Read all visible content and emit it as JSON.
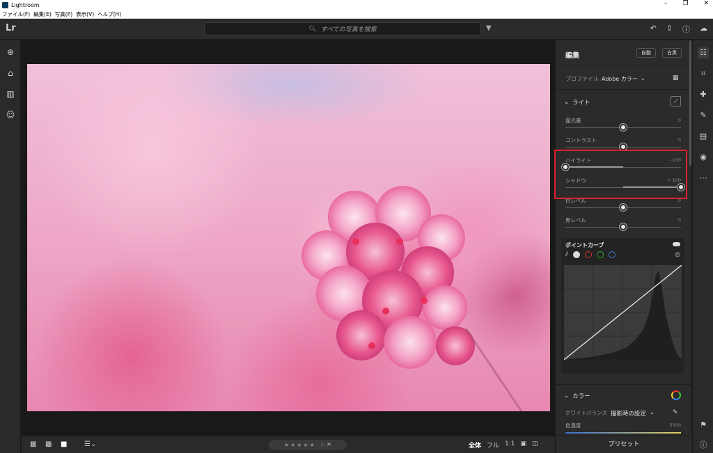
{
  "window": {
    "title": "Lightroom",
    "controls": [
      "–",
      "❐",
      "✕"
    ]
  },
  "menu": [
    "ファイル(F)",
    "編集(E)",
    "写真(P)",
    "表示(V)",
    "ヘルプ(H)"
  ],
  "topbar": {
    "logo": "Lr",
    "search_placeholder": "すべての写真を検索"
  },
  "bottom": {
    "zoom_fit": "全体",
    "zoom_fill": "フル",
    "zoom_1to1": "1:1"
  },
  "panel": {
    "title": "編集",
    "auto_button": "自動",
    "bw_button": "白黒",
    "profile_label": "プロファイル",
    "profile_value": "Adobe カラー",
    "light_section": "ライト",
    "sliders": [
      {
        "label": "露光量",
        "value": "0",
        "level": 0.5
      },
      {
        "label": "コントラスト",
        "value": "0",
        "level": 0.5
      },
      {
        "label": "ハイライト",
        "value": "- 100",
        "level": 0.0
      },
      {
        "label": "シャドウ",
        "value": "+ 100",
        "level": 1.0
      },
      {
        "label": "白レベル",
        "value": "0",
        "level": 0.5
      },
      {
        "label": "黒レベル",
        "value": "0",
        "level": 0.5
      }
    ],
    "point_curve_title": "ポイントカーブ",
    "color_section": "カラー",
    "wb_label": "ホワイトバランス",
    "wb_value": "撮影時の設定",
    "temp_label": "色温度",
    "temp_value": "5500",
    "presets": "プリセット"
  },
  "colors": {
    "accent_red": "#e0202c",
    "panel_bg": "#2b2b2b"
  }
}
